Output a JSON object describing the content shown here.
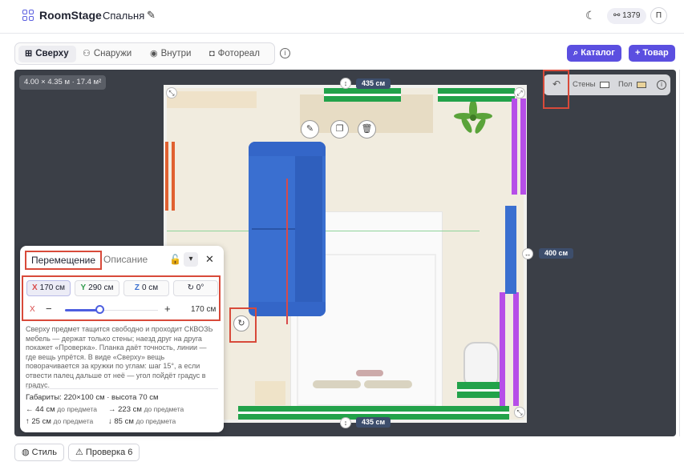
{
  "header": {
    "brand": "RoomStage",
    "room_name": "Спальня",
    "credits": "1379",
    "avatar_initial": "П"
  },
  "view_tabs": [
    {
      "label": "Сверху",
      "icon": "grid-icon",
      "active": true
    },
    {
      "label": "Снаружи",
      "icon": "people-icon",
      "active": false
    },
    {
      "label": "Внутри",
      "icon": "eye-icon",
      "active": false
    },
    {
      "label": "Фотореал",
      "icon": "camera-icon",
      "active": false
    }
  ],
  "toolbar": {
    "catalog_label": "Каталог",
    "add_product_label": "Товар"
  },
  "canvas": {
    "room_dims": "4.00 × 4.35 м · 17.4 м²",
    "measure_top": "435 см",
    "measure_bottom": "435 см",
    "measure_right": "400 см",
    "toggle_walls_label": "Стены",
    "toggle_floor_label": "Пол",
    "accent_color": "#5b4fe0",
    "wall_colors": {
      "green": "#22a24a",
      "purple": "#b64ee8",
      "orange": "#e06030",
      "blue": "#3a6fd0"
    }
  },
  "panel": {
    "tab_move": "Перемещение",
    "tab_description": "Описание",
    "x_chip": "170 см",
    "y_chip": "290 см",
    "z_chip": "0 см",
    "rotation_chip": "0°",
    "axis_label": "X",
    "slider_value": "170 см",
    "x_label": "X",
    "y_label": "Y",
    "z_label": "Z",
    "help_text": "Сверху предмет тащится свободно и проходит СКВОЗЬ мебель — держат только стены; наезд друг на друга покажет «Проверка». Планка даёт точность, линии — где вещь упрётся. В виде «Сверху» вещь поворачивается за кружки по углам: шаг 15°, а если отвести палец дальше от неё — угол пойдёт градус в градус.",
    "dimensions": "Габариты: 220×100 см · высота 70 см",
    "dist_left_value": "44 см",
    "dist_right_value": "223 см",
    "dist_up_value": "25 см",
    "dist_down_value": "85 см",
    "dist_suffix": "до предмета"
  },
  "bottom": {
    "style_label": "Стиль",
    "check_label": "Проверка 6"
  }
}
